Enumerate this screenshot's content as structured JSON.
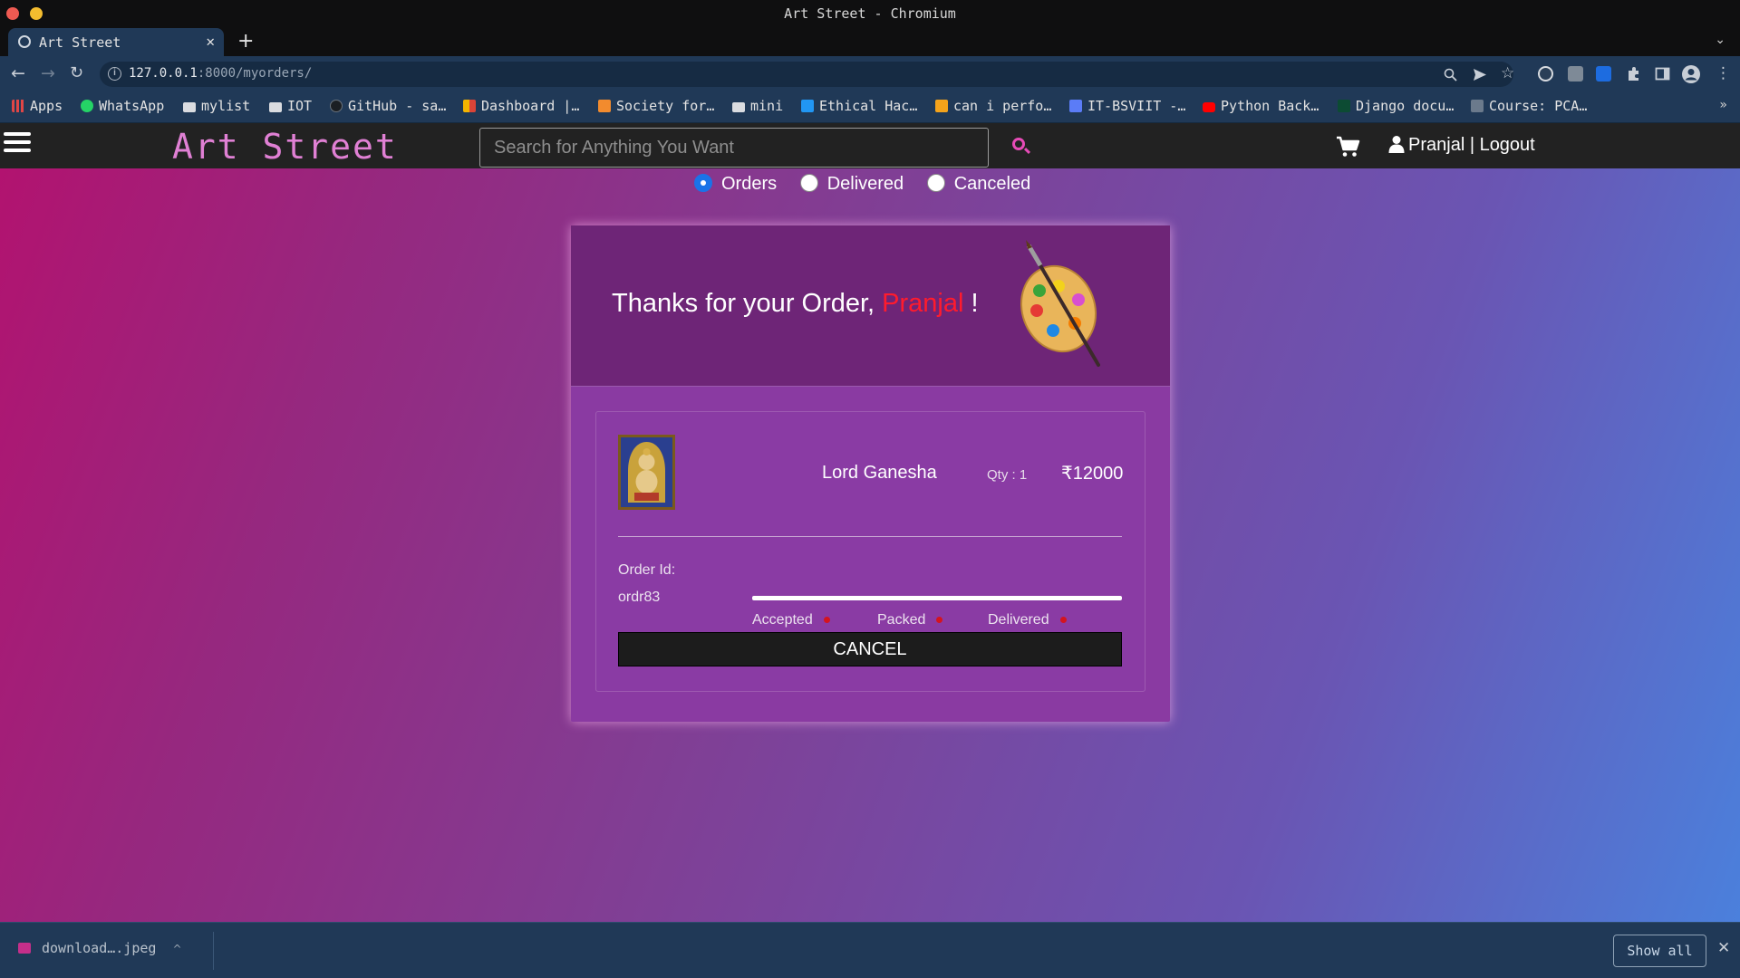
{
  "window": {
    "title": "Art Street - Chromium"
  },
  "tabs": [
    {
      "label": "Art Street"
    }
  ],
  "toolbar": {
    "url_host": "127.0.0.1",
    "url_rest": ":8000/myorders/"
  },
  "bookmarks": [
    {
      "label": "Apps",
      "icon": "apps-grid-icon",
      "color": "#e8eaed"
    },
    {
      "label": "WhatsApp",
      "icon": "whatsapp-icon",
      "color": "#25d366"
    },
    {
      "label": "mylist",
      "icon": "folder-icon",
      "color": "#dadce0"
    },
    {
      "label": "IOT",
      "icon": "folder-icon",
      "color": "#dadce0"
    },
    {
      "label": "GitHub - sa…",
      "icon": "github-icon",
      "color": "#1b1f23"
    },
    {
      "label": "Dashboard |…",
      "icon": "dashboard-icon",
      "color": "#f4b400"
    },
    {
      "label": "Society for…",
      "icon": "society-icon",
      "color": "#f28b2e"
    },
    {
      "label": "mini",
      "icon": "folder-icon",
      "color": "#dadce0"
    },
    {
      "label": "Ethical Hac…",
      "icon": "ethical-hacking-icon",
      "color": "#2196f3"
    },
    {
      "label": "can i perfo…",
      "icon": "bookmark-icon",
      "color": "#f4a31b"
    },
    {
      "label": "IT-BSVIIT -…",
      "icon": "teams-icon",
      "color": "#5b7cf7"
    },
    {
      "label": "Python Back…",
      "icon": "youtube-icon",
      "color": "#ff0000"
    },
    {
      "label": "Django docu…",
      "icon": "django-icon",
      "color": "#0c4b33"
    },
    {
      "label": "Course: PCA…",
      "icon": "course-icon",
      "color": "#6b7a8c"
    }
  ],
  "site": {
    "brand": "Art Street",
    "search_placeholder": "Search for Anything You Want",
    "user_link": "Pranjal | Logout"
  },
  "filters": [
    {
      "label": "Orders",
      "checked": true
    },
    {
      "label": "Delivered",
      "checked": false
    },
    {
      "label": "Canceled",
      "checked": false
    }
  ],
  "order": {
    "thanks_prefix": "Thanks for your Order, ",
    "customer_name": "Pranjal",
    "thanks_suffix": " !",
    "product_name": "Lord Ganesha",
    "qty": "Qty : 1",
    "price": "₹12000",
    "order_id_label": "Order Id:",
    "order_id": "ordr83",
    "stages": [
      "Accepted",
      "Packed",
      "Delivered"
    ],
    "cancel_label": "CANCEL",
    "name_color": "#ff1b2d"
  },
  "downloads": {
    "file": "download….jpeg",
    "show_all": "Show all"
  }
}
